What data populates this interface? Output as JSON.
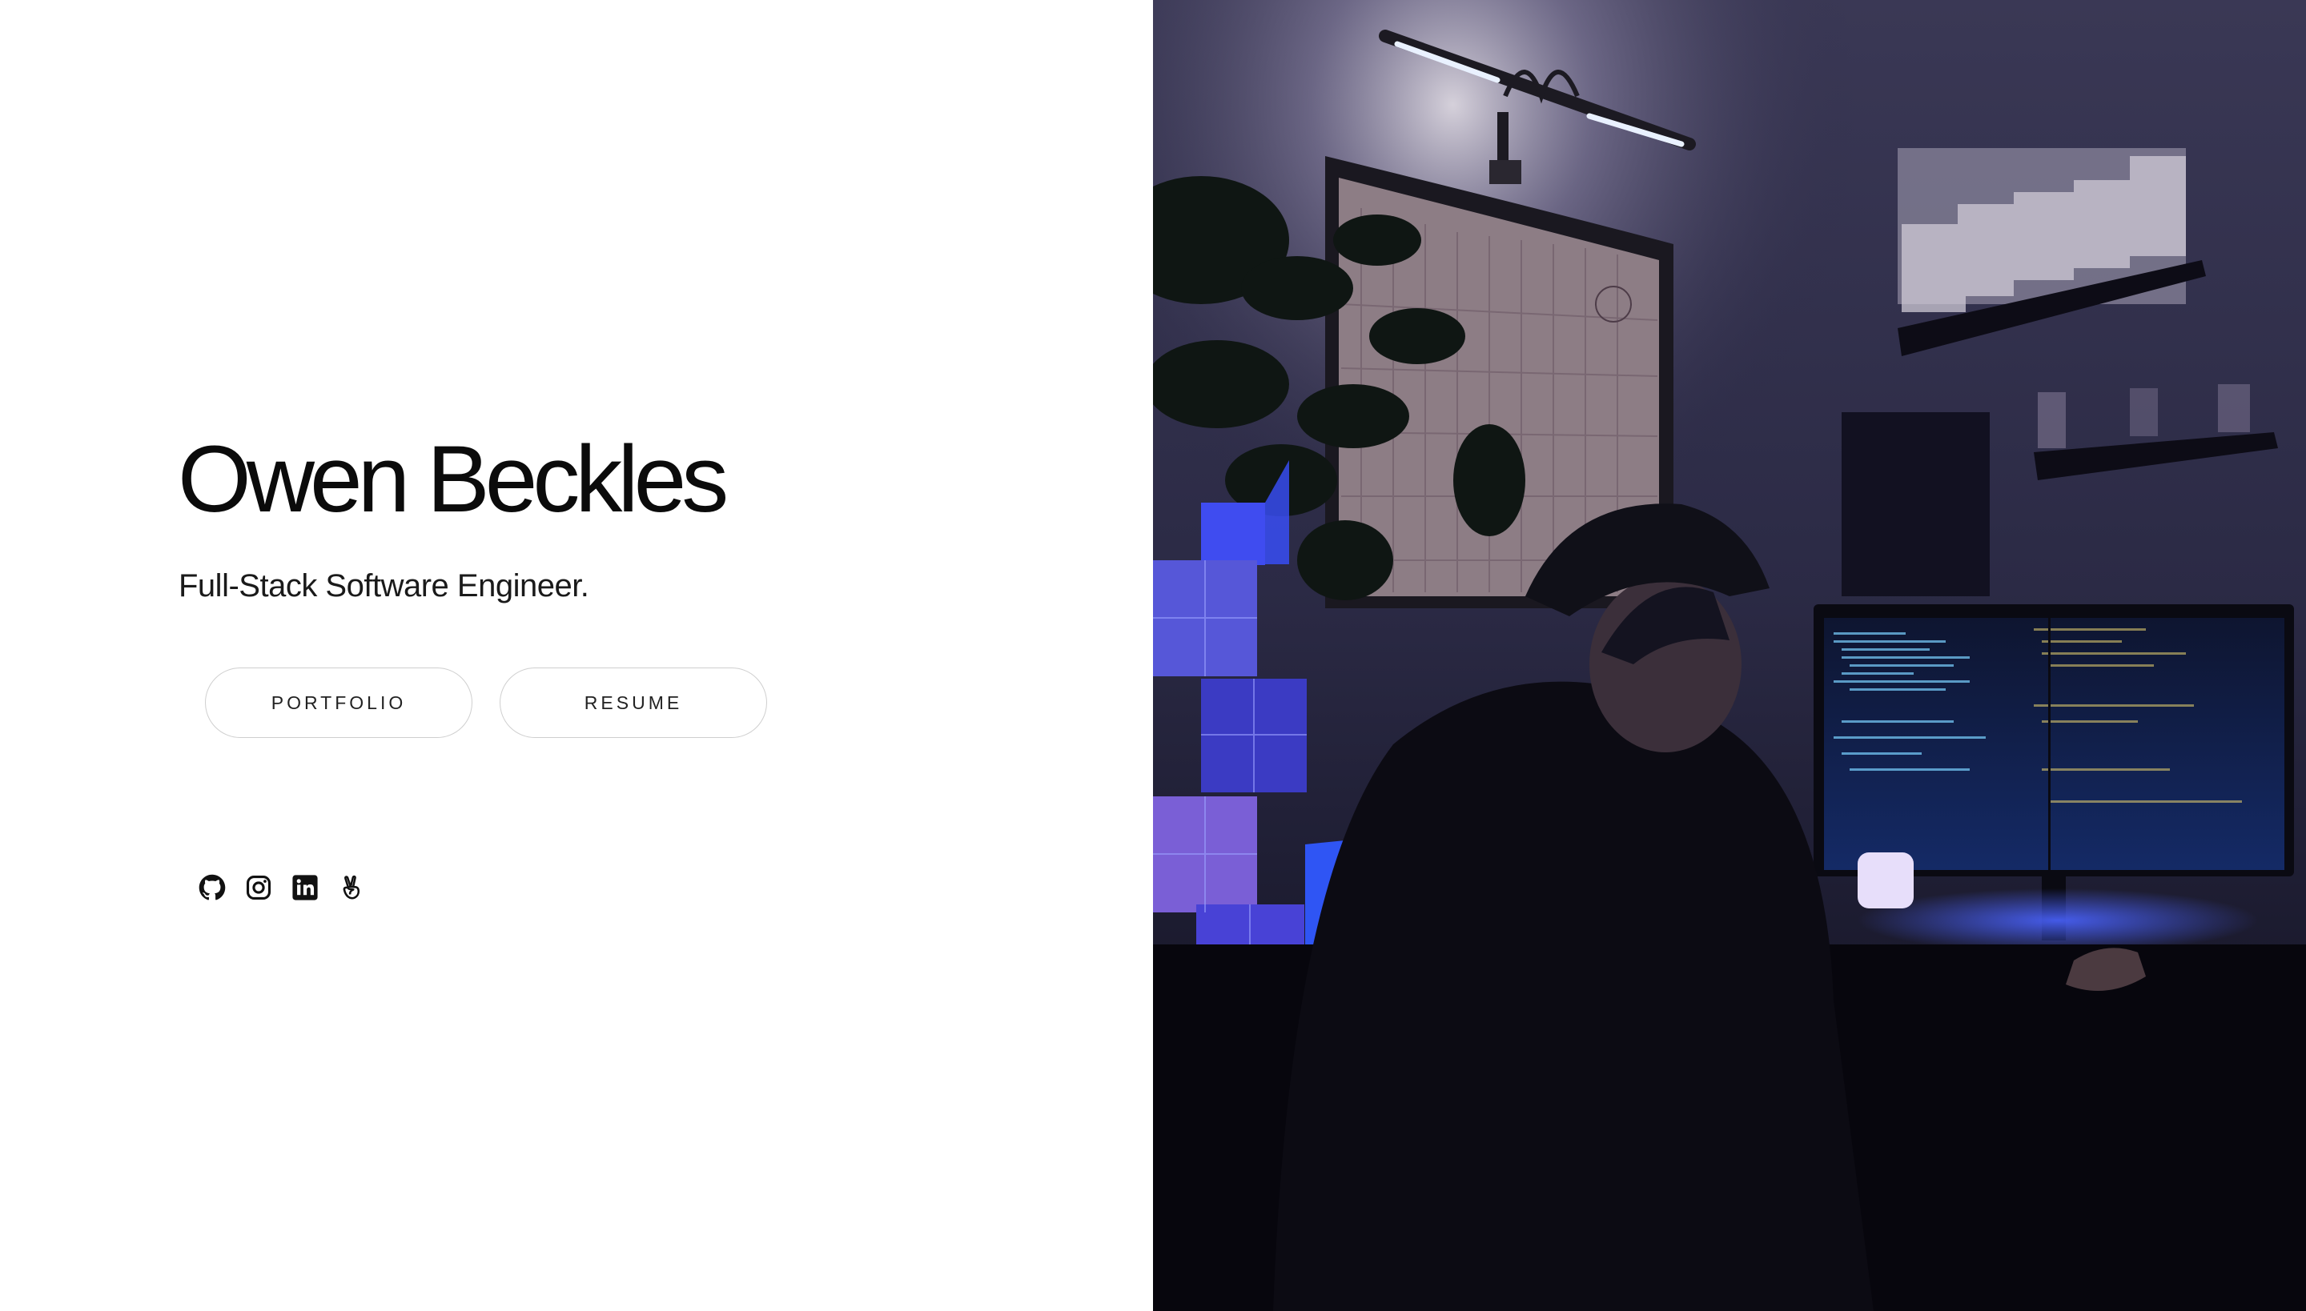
{
  "hero": {
    "name": "Owen Beckles",
    "tagline": "Full-Stack Software Engineer."
  },
  "buttons": {
    "portfolio": "PORTFOLIO",
    "resume": "RESUME"
  },
  "socials": [
    {
      "icon": "github-icon"
    },
    {
      "icon": "instagram-icon"
    },
    {
      "icon": "linkedin-icon"
    },
    {
      "icon": "angellist-icon"
    }
  ],
  "photo": {
    "subject": "developer-workspace-photo"
  },
  "colors": {
    "background": "#ffffff",
    "text": "#0b0b0b",
    "button_border": "#cfcfcf",
    "photo_tint": "#1b1a2e",
    "accent_blue": "#3c45e6"
  }
}
